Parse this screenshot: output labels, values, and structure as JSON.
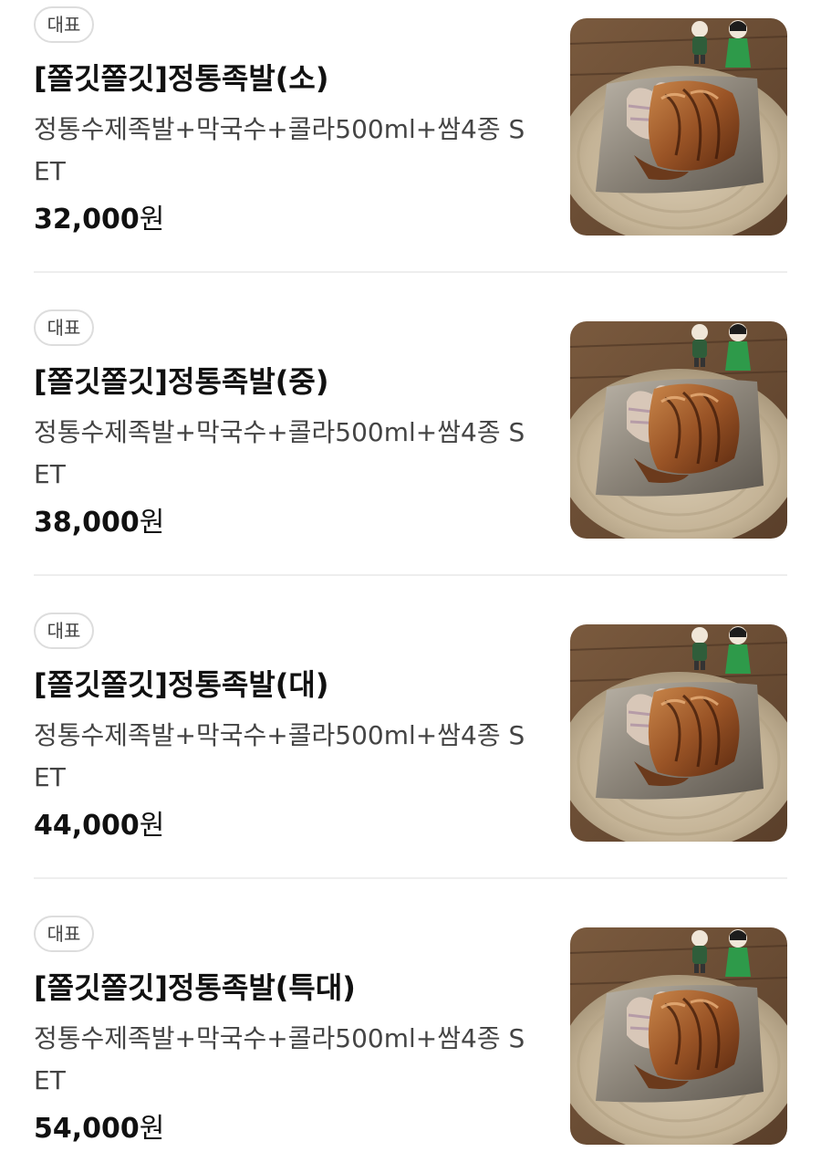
{
  "menu": {
    "items": [
      {
        "badge": "대표",
        "name": "[쫄깃쫄깃]정통족발(소)",
        "description": "정통수제족발+막국수+콜라500ml+쌈4종 SET",
        "price_amount": "32,000",
        "price_unit": "원",
        "image_icon": "food-photo-jokbal"
      },
      {
        "badge": "대표",
        "name": "[쫄깃쫄깃]정통족발(중)",
        "description": "정통수제족발+막국수+콜라500ml+쌈4종 SET",
        "price_amount": "38,000",
        "price_unit": "원",
        "image_icon": "food-photo-jokbal"
      },
      {
        "badge": "대표",
        "name": "[쫄깃쫄깃]정통족발(대)",
        "description": "정통수제족발+막국수+콜라500ml+쌈4종 SET",
        "price_amount": "44,000",
        "price_unit": "원",
        "image_icon": "food-photo-jokbal"
      },
      {
        "badge": "대표",
        "name": "[쫄깃쫄깃]정통족발(특대)",
        "description": "정통수제족발+막국수+콜라500ml+쌈4종 SET",
        "price_amount": "54,000",
        "price_unit": "원",
        "image_icon": "food-photo-jokbal"
      }
    ]
  },
  "colors": {
    "text_primary": "#111111",
    "text_secondary": "#444444",
    "badge_border": "#dddddd",
    "divider": "#eeeeee"
  }
}
